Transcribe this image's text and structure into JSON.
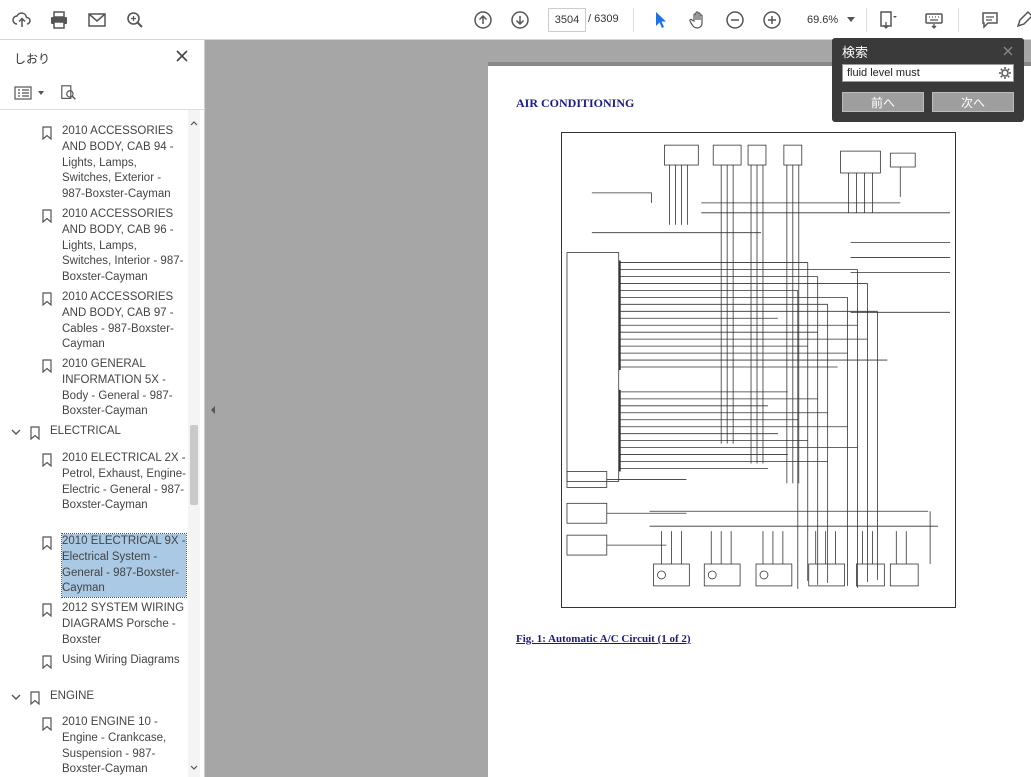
{
  "toolbar": {
    "page_current": "3504",
    "page_total": "/ 6309",
    "zoom": "69.6%",
    "icons": [
      "upload-icon",
      "print-icon",
      "mail-icon",
      "search-icon",
      "page-up-icon",
      "page-down-icon",
      "select-cursor-icon",
      "hand-icon",
      "zoom-out-icon",
      "zoom-in-icon",
      "page-fit-icon",
      "keyboard-icon",
      "comment-icon",
      "pen-icon"
    ]
  },
  "sidebar": {
    "title": "しおり",
    "nodes": [
      {
        "text": "2010 ACCESSORIES AND BODY, CAB 94 - Lights, Lamps, Switches, Exterior - 987-Boxster-Cayman"
      },
      {
        "text": "2010 ACCESSORIES AND BODY, CAB 96 - Lights, Lamps, Switches, Interior - 987-Boxster-Cayman"
      },
      {
        "text": "2010 ACCESSORIES AND BODY, CAB 97 - Cables - 987-Boxster-Cayman"
      },
      {
        "text": "2010 GENERAL INFORMATION 5X - Body - General - 987-Boxster-Cayman"
      }
    ],
    "cat_electrical": "ELECTRICAL",
    "electrical_nodes": [
      {
        "text": "2010 ELECTRICAL 2X - Petrol, Exhaust, Engine-Electric - General - 987-Boxster-Cayman"
      },
      {
        "text": "2010 ELECTRICAL 9X - Electrical System - General - 987-Boxster-Cayman"
      },
      {
        "text": "2012 SYSTEM WIRING DIAGRAMS Porsche - Boxster"
      },
      {
        "text": "Using Wiring Diagrams"
      }
    ],
    "cat_engine": "ENGINE",
    "engine_nodes": [
      {
        "text": "2010 ENGINE 10 - Engine - Crankcase, Suspension - 987-Boxster-Cayman"
      }
    ]
  },
  "document": {
    "heading": "AIR CONDITIONING",
    "caption": "Fig. 1: Automatic A/C Circuit (1 of 2)"
  },
  "find": {
    "title": "検索",
    "query": "fluid level must",
    "prev": "前へ",
    "next": "次へ"
  },
  "colors": {
    "accent": "#1a73e8",
    "doc_blue": "#1a1a8c",
    "selected": "#a9c9e4"
  }
}
